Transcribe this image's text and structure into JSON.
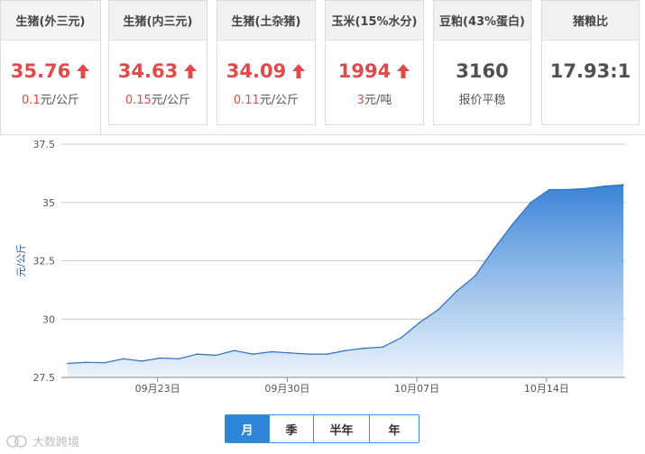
{
  "cards": [
    {
      "title": "生猪(外三元)",
      "value": "35.76",
      "trend": "up",
      "change": "0.1",
      "unit": "元/公斤"
    },
    {
      "title": "生猪(内三元)",
      "value": "34.63",
      "trend": "up",
      "change": "0.15",
      "unit": "元/公斤"
    },
    {
      "title": "生猪(土杂猪)",
      "value": "34.09",
      "trend": "up",
      "change": "0.11",
      "unit": "元/公斤"
    },
    {
      "title": "玉米(15%水分)",
      "value": "1994",
      "trend": "up",
      "change": "3",
      "unit": "元/吨"
    },
    {
      "title": "豆粕(43%蛋白)",
      "value": "3160",
      "trend": "flat",
      "note": "报价平稳"
    },
    {
      "title": "猪粮比",
      "value": "17.93:1",
      "trend": "none"
    }
  ],
  "colors": {
    "up": "#e24a4a",
    "accent": "#2f86d8",
    "area_top": "#3a84d6",
    "line": "#2d6fbf"
  },
  "chart_data": {
    "type": "area",
    "title": "",
    "xlabel": "",
    "ylabel": "元/公斤",
    "ylim": [
      27.5,
      37.5
    ],
    "yticks": [
      "27.5",
      "30",
      "32.5",
      "35",
      "37.5"
    ],
    "xticks": [
      "09月23日",
      "09月30日",
      "10月07日",
      "10月14日"
    ],
    "grid": true,
    "series": [
      {
        "values": [
          28.1,
          28.15,
          28.13,
          28.3,
          28.2,
          28.33,
          28.3,
          28.5,
          28.45,
          28.65,
          28.5,
          28.6,
          28.55,
          28.5,
          28.5,
          28.65,
          28.75,
          28.8,
          29.2,
          29.85,
          30.4,
          31.2,
          31.85,
          33.0,
          34.05,
          35.0,
          35.55,
          35.55,
          35.6,
          35.7,
          35.76
        ]
      }
    ]
  },
  "range_tabs": [
    "月",
    "季",
    "半年",
    "年"
  ],
  "range_selected": "月",
  "watermark": "大数跨境"
}
